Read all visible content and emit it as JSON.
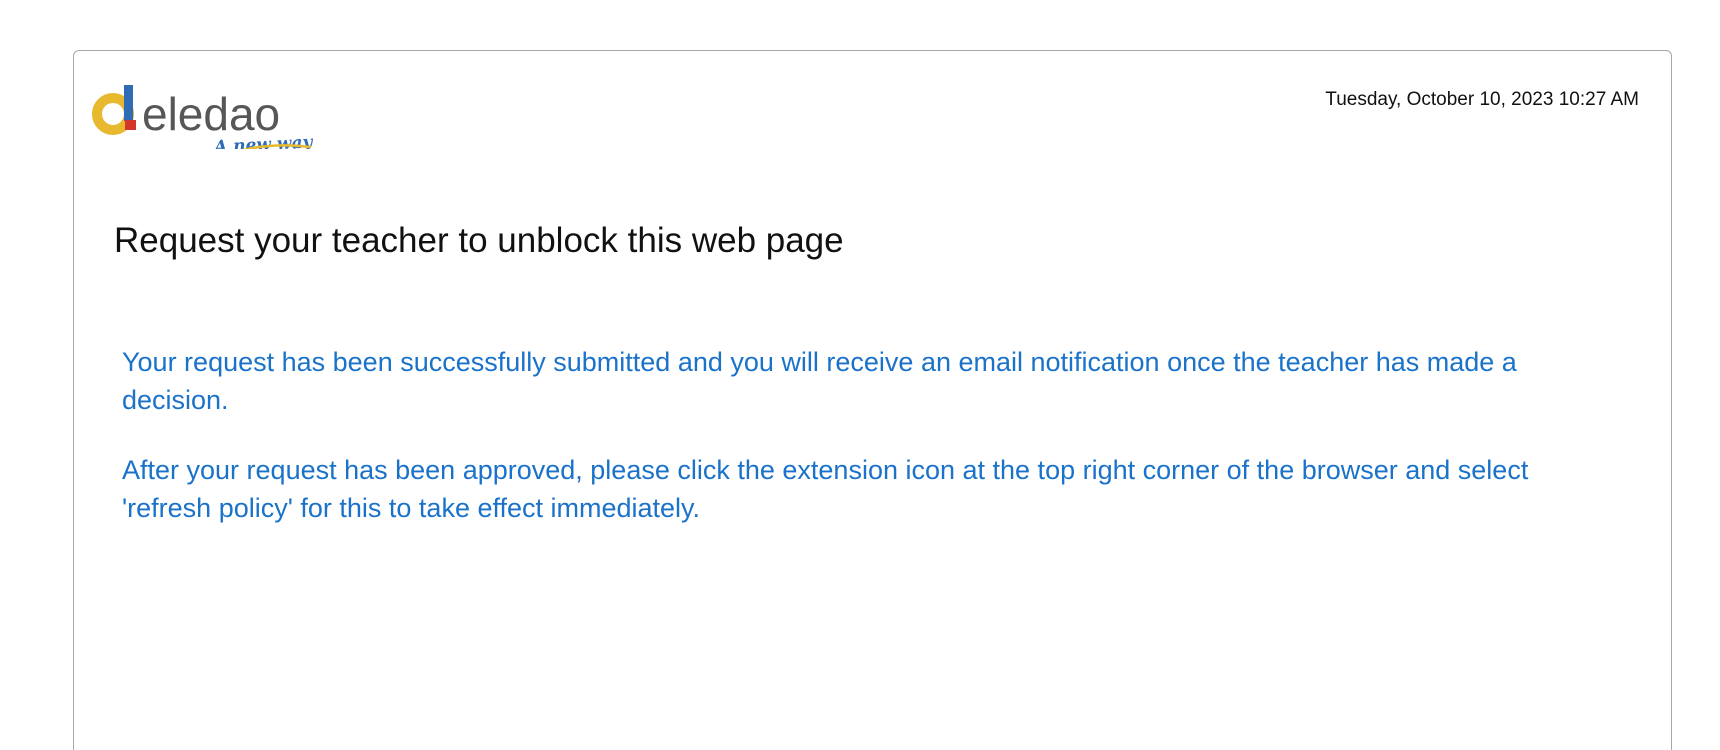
{
  "brand": {
    "name": "eledao",
    "tagline": "A new way",
    "colors": {
      "yellow": "#e8b92e",
      "red": "#d6352b",
      "blue": "#2f6cb5",
      "gray": "#57575a"
    }
  },
  "header": {
    "datetime": "Tuesday, October 10, 2023 10:27 AM"
  },
  "main": {
    "title": "Request your teacher to unblock this web page",
    "messages": [
      "Your request has been successfully submitted and you will receive an email notification once the teacher has made a decision.",
      "After your request has been approved, please click the extension icon at the top right corner of the browser and select 'refresh policy' for this to take effect immediately."
    ]
  },
  "colors": {
    "message_text": "#1a72c9",
    "card_border": "#a8a8a8"
  }
}
